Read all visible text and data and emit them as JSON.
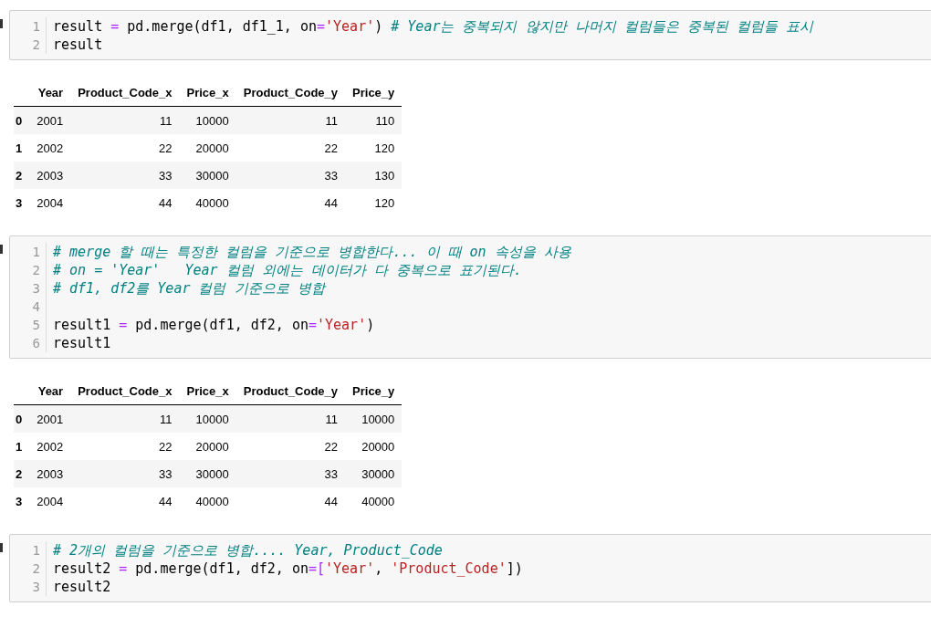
{
  "cells": [
    {
      "kind": "code",
      "lines": [
        {
          "number": "1",
          "tokens": [
            {
              "kind": "plain",
              "text": "result "
            },
            {
              "kind": "op",
              "text": "="
            },
            {
              "kind": "plain",
              "text": " pd.merge(df1, df1_1, on"
            },
            {
              "kind": "op",
              "text": "="
            },
            {
              "kind": "string",
              "text": "'Year'"
            },
            {
              "kind": "plain",
              "text": ") "
            },
            {
              "kind": "comment",
              "text": "# Year는 중복되지 않지만 나머지 컬럼들은 중복된 컬럼들 표시"
            }
          ]
        },
        {
          "number": "2",
          "tokens": [
            {
              "kind": "plain",
              "text": "result"
            }
          ]
        }
      ]
    },
    {
      "kind": "output",
      "columns": [
        "Year",
        "Product_Code_x",
        "Price_x",
        "Product_Code_y",
        "Price_y"
      ],
      "rows": [
        {
          "index": "0",
          "cells": [
            "2001",
            "11",
            "10000",
            "11",
            "110"
          ]
        },
        {
          "index": "1",
          "cells": [
            "2002",
            "22",
            "20000",
            "22",
            "120"
          ]
        },
        {
          "index": "2",
          "cells": [
            "2003",
            "33",
            "30000",
            "33",
            "130"
          ]
        },
        {
          "index": "3",
          "cells": [
            "2004",
            "44",
            "40000",
            "44",
            "120"
          ]
        }
      ]
    },
    {
      "kind": "code",
      "lines": [
        {
          "number": "1",
          "tokens": [
            {
              "kind": "comment",
              "text": "# merge 할 때는 특정한 컬럼을 기준으로 병합한다... 이 때 on 속성을 사용"
            }
          ]
        },
        {
          "number": "2",
          "tokens": [
            {
              "kind": "comment",
              "text": "# on = 'Year'   Year 컬럼 외에는 데이터가 다 중복으로 표기된다."
            }
          ]
        },
        {
          "number": "3",
          "tokens": [
            {
              "kind": "comment",
              "text": "# df1, df2를 Year 컬럼 기준으로 병합"
            }
          ]
        },
        {
          "number": "4"
        },
        {
          "number": "5",
          "tokens": [
            {
              "kind": "plain",
              "text": "result1 "
            },
            {
              "kind": "op",
              "text": "="
            },
            {
              "kind": "plain",
              "text": " pd.merge(df1, df2, on"
            },
            {
              "kind": "op",
              "text": "="
            },
            {
              "kind": "string",
              "text": "'Year'"
            },
            {
              "kind": "plain",
              "text": ")"
            }
          ]
        },
        {
          "number": "6",
          "tokens": [
            {
              "kind": "plain",
              "text": "result1"
            }
          ]
        }
      ]
    },
    {
      "kind": "output",
      "columns": [
        "Year",
        "Product_Code_x",
        "Price_x",
        "Product_Code_y",
        "Price_y"
      ],
      "rows": [
        {
          "index": "0",
          "cells": [
            "2001",
            "11",
            "10000",
            "11",
            "10000"
          ]
        },
        {
          "index": "1",
          "cells": [
            "2002",
            "22",
            "20000",
            "22",
            "20000"
          ]
        },
        {
          "index": "2",
          "cells": [
            "2003",
            "33",
            "30000",
            "33",
            "30000"
          ]
        },
        {
          "index": "3",
          "cells": [
            "2004",
            "44",
            "40000",
            "44",
            "40000"
          ]
        }
      ]
    },
    {
      "kind": "code",
      "lines": [
        {
          "number": "1",
          "tokens": [
            {
              "kind": "comment",
              "text": "# 2개의 컬럼을 기준으로 병합.... Year, Product_Code"
            }
          ]
        },
        {
          "number": "2",
          "tokens": [
            {
              "kind": "plain",
              "text": "result2 "
            },
            {
              "kind": "op",
              "text": "="
            },
            {
              "kind": "plain",
              "text": " pd.merge(df1, df2, on"
            },
            {
              "kind": "op",
              "text": "=["
            },
            {
              "kind": "string",
              "text": "'Year'"
            },
            {
              "kind": "plain",
              "text": ", "
            },
            {
              "kind": "string",
              "text": "'Product_Code'"
            },
            {
              "kind": "plain",
              "text": "])"
            }
          ]
        },
        {
          "number": "3",
          "tokens": [
            {
              "kind": "plain",
              "text": "result2"
            }
          ]
        }
      ]
    }
  ]
}
